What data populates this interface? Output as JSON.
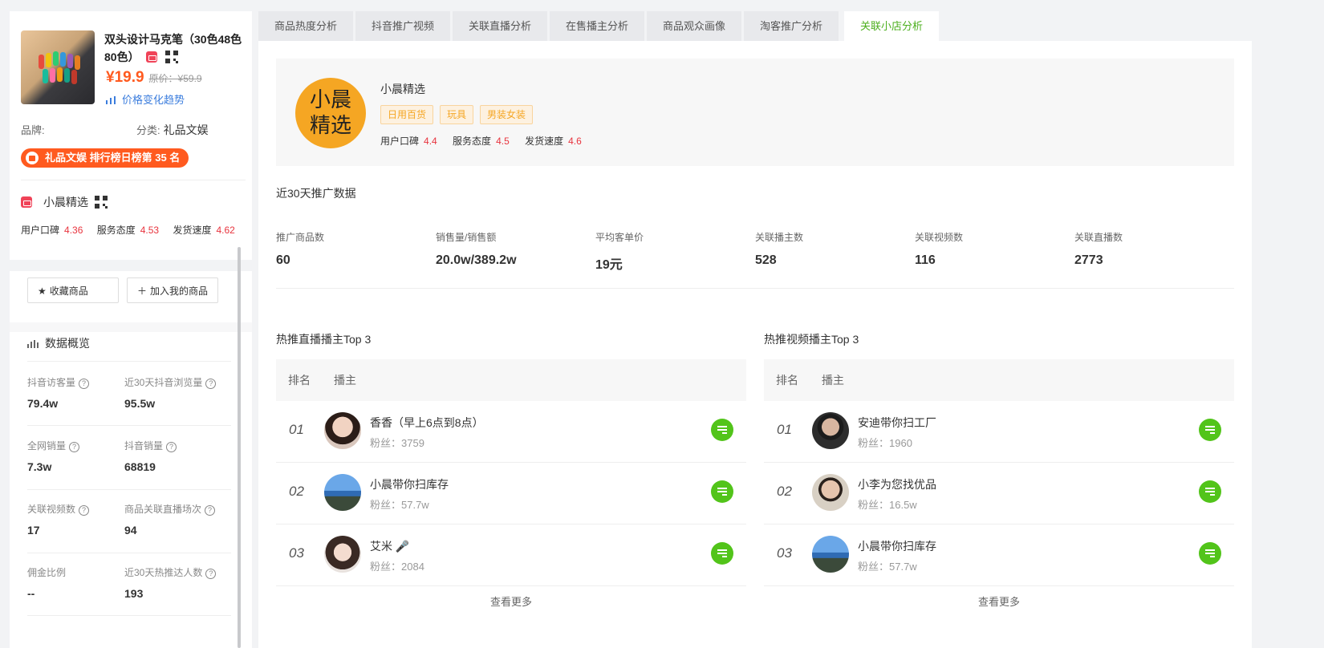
{
  "product": {
    "title": "双头设计马克笔（30色48色80色）",
    "price": "¥19.9",
    "original_price": "原价：¥59.9",
    "trend_link": "价格变化趋势",
    "brand_label": "品牌:",
    "category_label": "分类:",
    "category_value": "礼品文娱",
    "rank_badge": "礼品文娱 排行榜日榜第 35 名"
  },
  "left_shop": {
    "name": "小晨精选",
    "scores": [
      {
        "label": "用户口碑",
        "value": "4.36"
      },
      {
        "label": "服务态度",
        "value": "4.53"
      },
      {
        "label": "发货速度",
        "value": "4.62"
      }
    ]
  },
  "actions": {
    "favorite": "收藏商品",
    "add_mine": "加入我的商品"
  },
  "overview": {
    "title": "数据概览",
    "stats": [
      {
        "label": "抖音访客量",
        "value": "79.4w"
      },
      {
        "label": "近30天抖音浏览量",
        "value": "95.5w"
      },
      {
        "label": "全网销量",
        "value": "7.3w"
      },
      {
        "label": "抖音销量",
        "value": "68819"
      },
      {
        "label": "关联视频数",
        "value": "17"
      },
      {
        "label": "商品关联直播场次",
        "value": "94"
      },
      {
        "label": "佣金比例",
        "value": "--"
      },
      {
        "label": "近30天热推达人数",
        "value": "193"
      }
    ]
  },
  "tabs": [
    "商品热度分析",
    "抖音推广视频",
    "关联直播分析",
    "在售播主分析",
    "商品观众画像",
    "淘客推广分析",
    "关联小店分析"
  ],
  "active_tab": "关联小店分析",
  "shop": {
    "logo_text": [
      "小晨",
      "精选"
    ],
    "name": "小晨精选",
    "tags": [
      "日用百货",
      "玩具",
      "男装女装"
    ],
    "scores": [
      {
        "label": "用户口碑",
        "value": "4.4"
      },
      {
        "label": "服务态度",
        "value": "4.5"
      },
      {
        "label": "发货速度",
        "value": "4.6"
      }
    ]
  },
  "promo": {
    "title": "近30天推广数据",
    "metrics": [
      {
        "label": "推广商品数",
        "value": "60"
      },
      {
        "label": "销售量/销售额",
        "value": "20.0w/389.2w"
      },
      {
        "label": "平均客单价",
        "value": "19元"
      },
      {
        "label": "关联播主数",
        "value": "528"
      },
      {
        "label": "关联视频数",
        "value": "116"
      },
      {
        "label": "关联直播数",
        "value": "2773"
      }
    ]
  },
  "live_top": {
    "title": "热推直播播主Top 3",
    "col_rank": "排名",
    "col_host": "播主",
    "rows": [
      {
        "rank": "01",
        "name": "香香（早上6点到8点）",
        "fans": "粉丝：3759"
      },
      {
        "rank": "02",
        "name": "小晨带你扫库存",
        "fans": "粉丝：57.7w"
      },
      {
        "rank": "03",
        "name": "艾米 🎤",
        "fans": "粉丝：2084"
      }
    ],
    "more": "查看更多"
  },
  "video_top": {
    "title": "热推视频播主Top 3",
    "col_rank": "排名",
    "col_host": "播主",
    "rows": [
      {
        "rank": "01",
        "name": "安迪带你扫工厂",
        "fans": "粉丝：1960"
      },
      {
        "rank": "02",
        "name": "小李为您找优品",
        "fans": "粉丝：16.5w"
      },
      {
        "rank": "03",
        "name": "小晨带你扫库存",
        "fans": "粉丝：57.7w"
      }
    ],
    "more": "查看更多"
  },
  "colors": {
    "accent_green": "#52c41a",
    "price_orange": "#ff5a1f",
    "score_red": "#e8343e",
    "link_blue": "#3b7ddd"
  }
}
